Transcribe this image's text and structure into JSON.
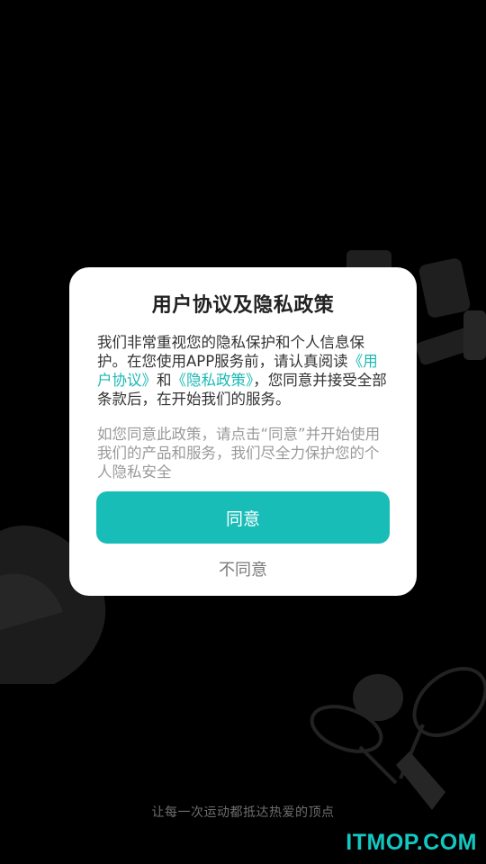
{
  "dialog": {
    "title": "用户协议及隐私政策",
    "body_text_1": "我们非常重视您的隐私保护和个人信息保护。在您使用APP服务前，请认真阅读",
    "link_user_agreement": "《用户协议》",
    "body_and": "和",
    "link_privacy_policy": "《隐私政策》",
    "body_text_2": "，您同意并接受全部条款后，在开始我们的服务。",
    "note_text": "如您同意此政策，请点击“同意”并开始使用我们的产品和服务，我们尽全力保护您的个人隐私安全",
    "agree_label": "同意",
    "disagree_label": "不同意"
  },
  "slogan": "让每一次运动都抵达热爱的顶点",
  "watermark": "ITMOP.COM",
  "colors": {
    "background": "#000000",
    "accent": "#19bdb8",
    "link": "#19b9b4",
    "watermark": "#11c9c1"
  },
  "icons": {
    "background_left": "fitness-equipment-silhouette",
    "background_right": "dumbbell-silhouette",
    "background_bottom": "tennis-rackets-silhouette"
  }
}
